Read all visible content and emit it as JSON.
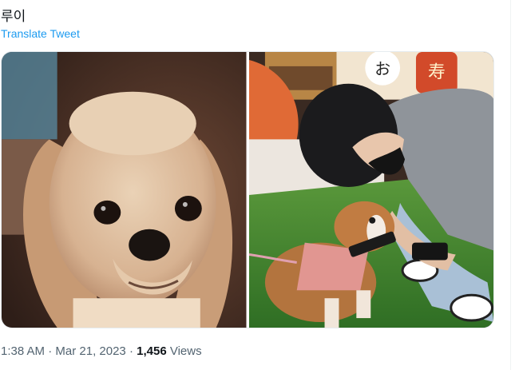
{
  "tweet": {
    "text": "루이",
    "translate_label": "Translate Tweet",
    "time": "1:38 AM",
    "separator": "·",
    "date": "Mar 21, 2023",
    "views_count": "1,456",
    "views_label": "Views"
  },
  "colors": {
    "link": "#1d9bf0",
    "meta": "#536471",
    "text": "#0f1419"
  },
  "media": {
    "photos": [
      {
        "subject": "cocker-spaniel-closeup"
      },
      {
        "subject": "person-petting-spaniel"
      }
    ],
    "sign_glyphs": [
      "お",
      "寿"
    ]
  }
}
